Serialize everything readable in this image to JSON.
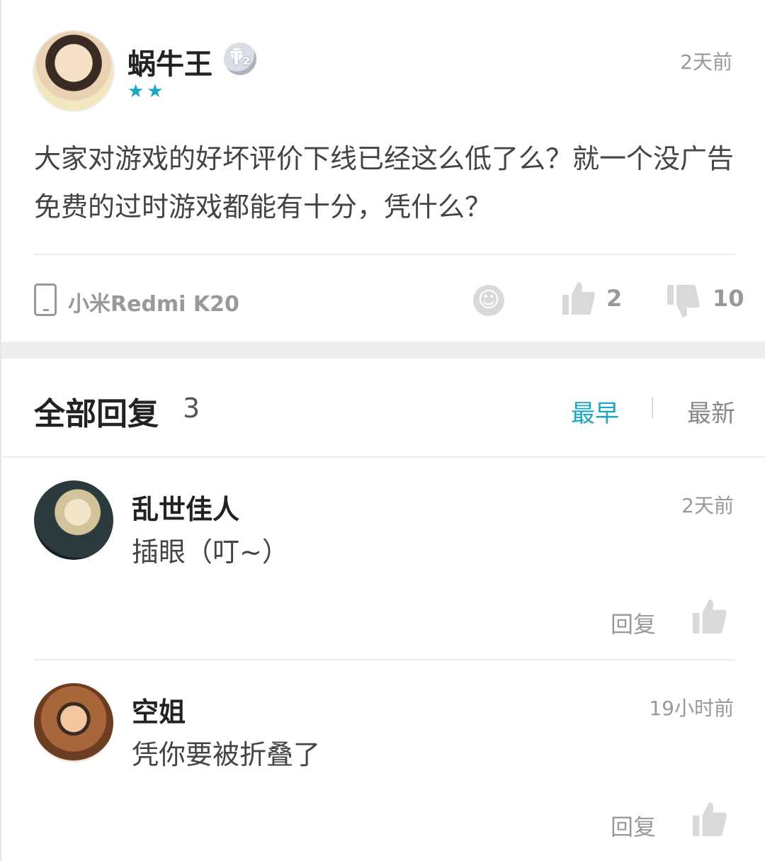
{
  "post": {
    "username": "蜗牛王",
    "level_badge": "T₂",
    "stars": "★★",
    "time": "2天前",
    "body": "大家对游戏的好坏评价下线已经这么低了么？就一个没广告免费的过时游戏都能有十分，凭什么？",
    "device": "小米Redmi K20",
    "likes": "2",
    "dislikes": "10"
  },
  "replies_section": {
    "title": "全部回复",
    "count": "3",
    "sort_earliest": "最早",
    "sort_latest": "最新"
  },
  "replies": [
    {
      "username": "乱世佳人",
      "time": "2天前",
      "text": "插眼（叮~）",
      "reply_label": "回复"
    },
    {
      "username": "空姐",
      "time": "19小时前",
      "text": "凭你要被折叠了",
      "reply_label": "回复"
    }
  ],
  "colors": {
    "accent": "#1aa7c2",
    "muted": "#999999",
    "section_gap": "#eeeeee"
  },
  "icons": [
    "phone-icon",
    "emoji-icon",
    "thumbs-up-icon",
    "thumbs-down-icon"
  ]
}
